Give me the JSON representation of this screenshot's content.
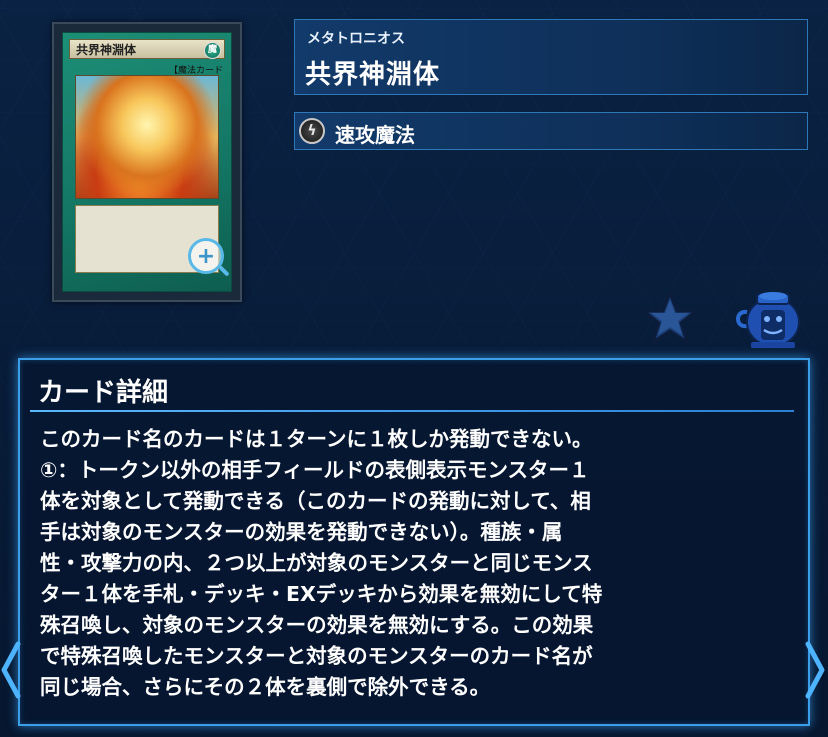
{
  "card": {
    "art_name": "共界神淵体",
    "art_type_line": "【魔法カード",
    "zoom_icon": "zoom-in-icon"
  },
  "header": {
    "ruby": "メタトロニオス",
    "name": "共界神淵体"
  },
  "type": {
    "icon": "quick-play-spell-icon",
    "label": "速攻魔法"
  },
  "actions": {
    "favorite_icon": "star-icon",
    "pot_icon": "pot-of-greed-icon"
  },
  "detail": {
    "title": "カード詳細",
    "text": "このカード名のカードは１ターンに１枚しか発動できない。\n①：トークン以外の相手フィールドの表側表示モンスター１\n体を対象として発動できる（このカードの発動に対して、相\n手は対象のモンスターの効果を発動できない）。種族・属\n性・攻撃力の内、２つ以上が対象のモンスターと同じモンス\nター１体を手札・デッキ・EXデッキから効果を無効にして特\n殊召喚し、対象のモンスターの効果を無効にする。この効果\nで特殊召喚したモンスターと対象のモンスターのカード名が\n同じ場合、さらにその２体を裏側で除外できる。"
  },
  "nav": {
    "prev_icon": "chevron-left-icon",
    "next_icon": "chevron-right-icon"
  },
  "colors": {
    "background": "#0a1c36",
    "panel_border": "#3a9ee8",
    "accent": "#58b8e8"
  }
}
